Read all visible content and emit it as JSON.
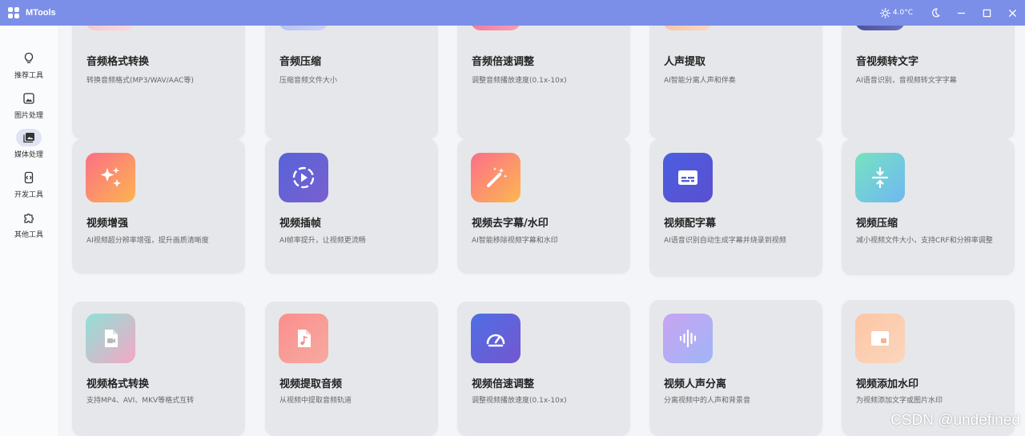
{
  "titlebar": {
    "app_title": "MTools",
    "weather_text": "4.0°C",
    "accent": "#7b8ee8"
  },
  "sidebar": {
    "items": [
      {
        "label": "推荐工具",
        "icon": "lightbulb-icon",
        "active": false
      },
      {
        "label": "图片处理",
        "icon": "image-icon",
        "active": false
      },
      {
        "label": "媒体处理",
        "icon": "media-icon",
        "active": true
      },
      {
        "label": "开发工具",
        "icon": "code-icon",
        "active": false
      },
      {
        "label": "其他工具",
        "icon": "puzzle-icon",
        "active": false
      }
    ]
  },
  "cards": {
    "row1": [
      {
        "title": "音频格式转换",
        "desc": "转换音频格式(MP3/WAV/AAC等)"
      },
      {
        "title": "音频压缩",
        "desc": "压缩音频文件大小"
      },
      {
        "title": "音频倍速调整",
        "desc": "调整音频播放速度(0.1x-10x)"
      },
      {
        "title": "人声提取",
        "desc": "AI智能分离人声和伴奏"
      },
      {
        "title": "音视频转文字",
        "desc": "AI语音识别，音视频转文字字幕"
      }
    ],
    "row2": [
      {
        "title": "视频增强",
        "desc": "AI视频超分辨率增强，提升画质清晰度",
        "icon": "sparkles-icon"
      },
      {
        "title": "视频插帧",
        "desc": "AI帧率提升，让视频更流畅",
        "icon": "play-circle-icon"
      },
      {
        "title": "视频去字幕/水印",
        "desc": "AI智能移除视频字幕和水印",
        "icon": "magic-wand-icon"
      },
      {
        "title": "视频配字幕",
        "desc": "AI语音识别自动生成字幕并烧录到视频",
        "icon": "subtitles-icon"
      },
      {
        "title": "视频压缩",
        "desc": "减小视频文件大小，支持CRF和分辨率调整",
        "icon": "compress-icon"
      }
    ],
    "row3": [
      {
        "title": "视频格式转换",
        "desc": "支持MP4、AVI、MKV等格式互转",
        "icon": "video-file-icon"
      },
      {
        "title": "视频提取音频",
        "desc": "从视频中提取音频轨道",
        "icon": "music-file-icon"
      },
      {
        "title": "视频倍速调整",
        "desc": "调整视频播放速度(0.1x-10x)",
        "icon": "speedometer-icon"
      },
      {
        "title": "视频人声分离",
        "desc": "分离视频中的人声和背景音",
        "icon": "waveform-icon"
      },
      {
        "title": "视频添加水印",
        "desc": "为视频添加文字或图片水印",
        "icon": "watermark-icon"
      }
    ]
  },
  "watermark": "CSDN @undefined"
}
